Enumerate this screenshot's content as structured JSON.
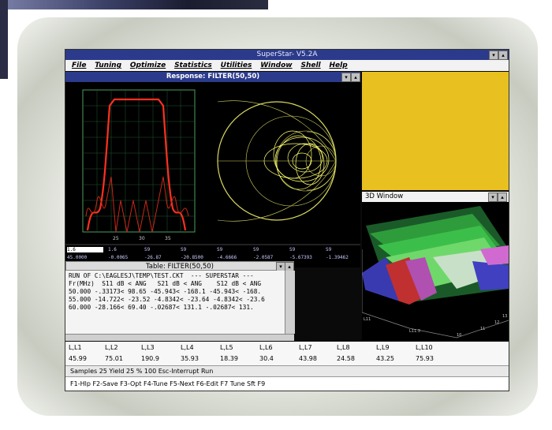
{
  "app": {
    "title": "SuperStar- V5.2A",
    "menu": [
      "File",
      "Tuning",
      "Optimize",
      "Statistics",
      "Utilities",
      "Window",
      "Shell",
      "Help"
    ]
  },
  "response": {
    "title": "Response: FILTER(50,50)",
    "x_ticks": [
      "25",
      "30",
      "35"
    ],
    "readout_row1": [
      "1.6",
      "1.6",
      "S9",
      "S9",
      "S9",
      "S9",
      "S9",
      "S9"
    ],
    "readout_row2": [
      "45.0000",
      "-0.0065",
      "-26.87",
      "-20.8500",
      "-4.6666",
      "-2.0587",
      "-5.67393",
      "-1.39462"
    ]
  },
  "window3d": {
    "title": "3D Window",
    "axis_labels": [
      "10",
      "11",
      "12",
      "13",
      "L11",
      "L11.3"
    ]
  },
  "table": {
    "title": "Table: FILTER(50,50)",
    "lines": [
      "RUN OF C:\\EAGLESJ\\TEMP\\TEST.CKT  --- SUPERSTAR ---",
      "",
      "Fr(MHz)  S11 dB < ANG   S21 dB < ANG    S12 dB < ANG",
      "50.000 -.33173< 98.65 -45.943< -168.1 -45.943< -168.",
      "55.000 -14.722< -23.52 -4.8342< -23.64 -4.8342< -23.6",
      "60.000 -28.166< 69.40 -.02687< 131.1 -.02687< 131."
    ]
  },
  "variables": {
    "headers": [
      "L,L1",
      "L,L2",
      "L,L3",
      "L,L4",
      "L,L5",
      "L,L6",
      "L,L7",
      "L,L8",
      "L,L9",
      "L,L10"
    ],
    "values": [
      "45.99",
      "75.01",
      "190.9",
      "35.93",
      "18.39",
      "30.4",
      "43.98",
      "24.58",
      "43.25",
      "75.93"
    ]
  },
  "status": {
    "line1": "Samples 25   Yield 25   % 100  Esc-Interrupt Run",
    "line2": "F1-Hlp F2-Save F3-Opt F4-Tune F5-Next F6-Edit  F7 Tune  Sft F9"
  },
  "colors": {
    "titlebar": "#2b3a8a",
    "trace": "#ff3020",
    "smith": "#e8e060",
    "panel": "#e8c020"
  }
}
